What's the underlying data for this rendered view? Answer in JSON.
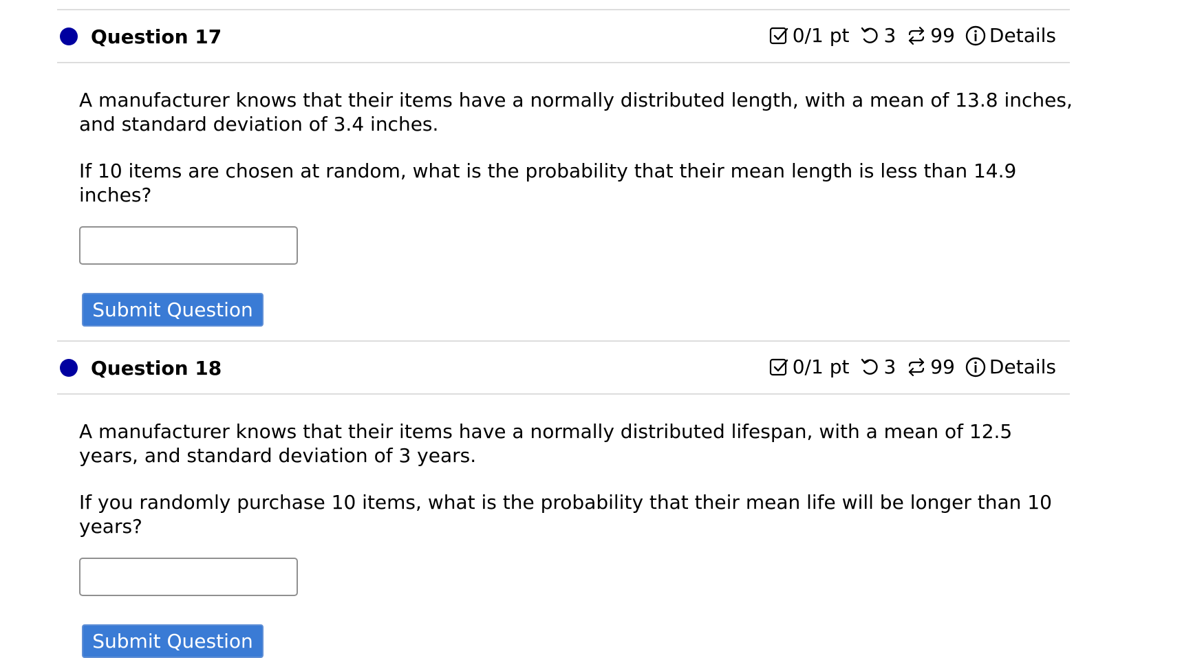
{
  "colors": {
    "status_dot": "#0000a0",
    "submit_button": "#3a7bd5",
    "divider": "#dddddd"
  },
  "questions": [
    {
      "title": "Question 17",
      "score": "0/1 pt",
      "attempts": "3",
      "retries": "99",
      "details_label": "Details",
      "paragraph_1": "A manufacturer knows that their items have a normally distributed length, with a mean of 13.8 inches, and standard deviation of 3.4 inches.",
      "paragraph_2": "If 10 items are chosen at random, what is the probability that their mean length is less than 14.9 inches?",
      "answer_value": "",
      "submit_label": "Submit Question"
    },
    {
      "title": "Question 18",
      "score": "0/1 pt",
      "attempts": "3",
      "retries": "99",
      "details_label": "Details",
      "paragraph_1": "A manufacturer knows that their items have a normally distributed lifespan, with a mean of 12.5 years, and standard deviation of 3 years.",
      "paragraph_2": "If you randomly purchase 10 items, what is the probability that their mean life will be longer than 10 years?",
      "answer_value": "",
      "submit_label": "Submit Question"
    }
  ],
  "icons": {
    "score": "checkbox-icon",
    "attempts": "undo-icon",
    "retries": "repeat-icon",
    "details": "info-icon"
  }
}
